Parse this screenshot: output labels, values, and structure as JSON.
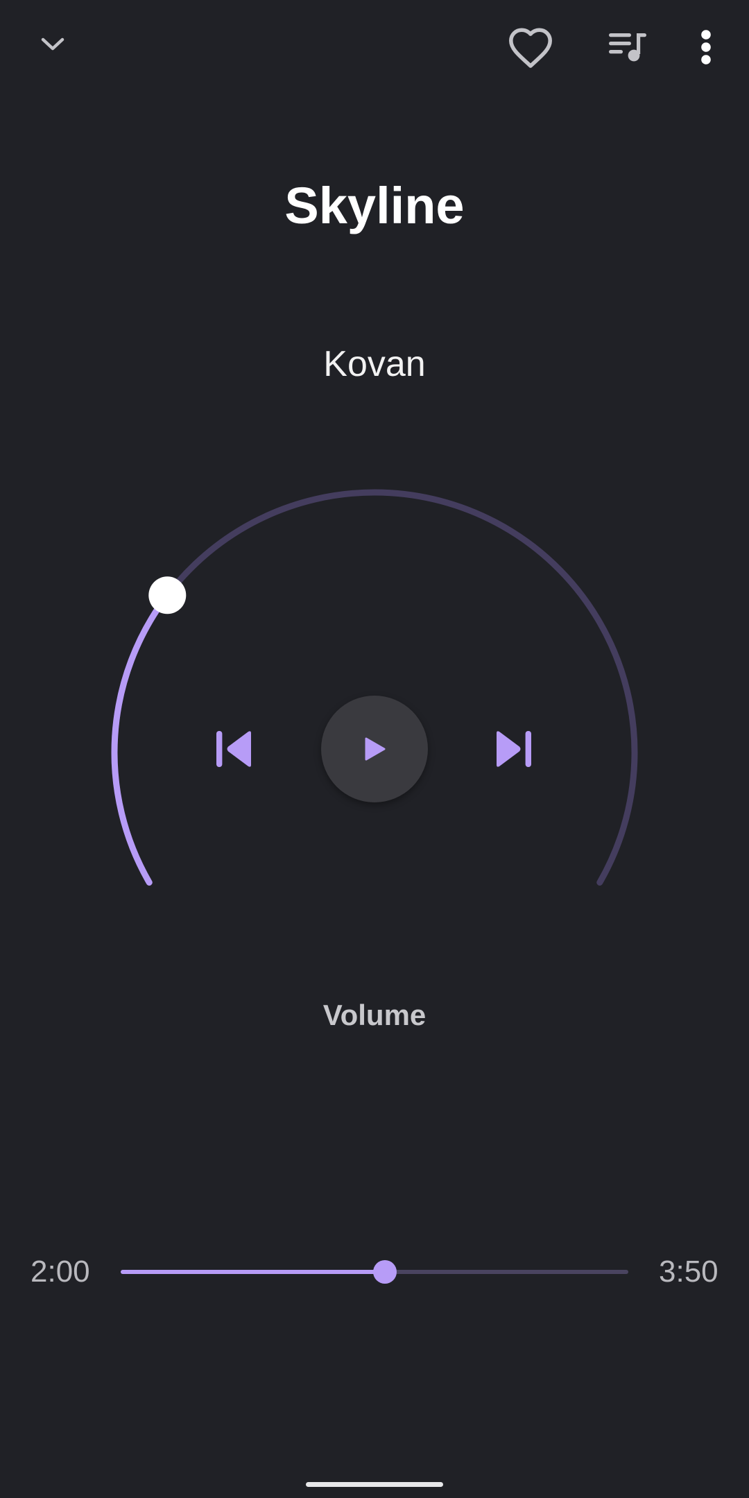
{
  "header": {
    "collapse_icon": "chevron-down-icon",
    "favorite_icon": "heart-outline-icon",
    "queue_icon": "queue-music-icon",
    "more_icon": "more-vertical-icon"
  },
  "track": {
    "title": "Skyline",
    "artist": "Kovan"
  },
  "controls": {
    "previous_icon": "skip-previous-icon",
    "play_icon": "play-icon",
    "next_icon": "skip-next-icon"
  },
  "volume": {
    "label": "Volume",
    "level": 0.28
  },
  "playback": {
    "elapsed": "2:00",
    "duration": "3:50",
    "progress": 0.52
  },
  "colors": {
    "background": "#202126",
    "accent": "#b79cf7",
    "track_inactive": "#443d5e",
    "play_button": "#3a3a3f"
  }
}
